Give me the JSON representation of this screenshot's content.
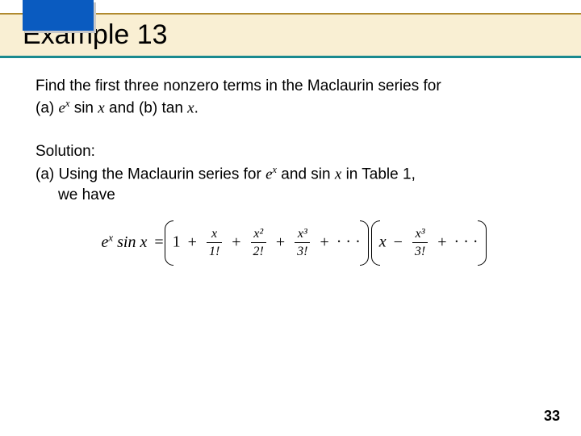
{
  "header": {
    "title": "Example 13"
  },
  "problem": {
    "line1": "Find the first three nonzero terms in the Maclaurin series for",
    "line2_prefix": "(a) ",
    "line2_mid": " sin ",
    "line2_and": " and (b) tan ",
    "line2_end": "."
  },
  "solution": {
    "label": "Solution:",
    "a_line1_prefix": "(a) Using the Maclaurin series for ",
    "a_line1_mid": " and sin ",
    "a_line1_suffix": " in Table 1,",
    "a_line2": "we have"
  },
  "math": {
    "lhs_e": "e",
    "lhs_sin": " sin ",
    "var_x": "x",
    "eq": "=",
    "one": "1",
    "plus": "+",
    "minus": "−",
    "dots": "· · ·",
    "f1_num": "x",
    "f1_den": "1!",
    "f2_num": "x²",
    "f2_den": "2!",
    "f3_num": "x³",
    "f3_den": "3!",
    "g1": "x",
    "g2_num": "x³",
    "g2_den": "3!"
  },
  "page": "33"
}
